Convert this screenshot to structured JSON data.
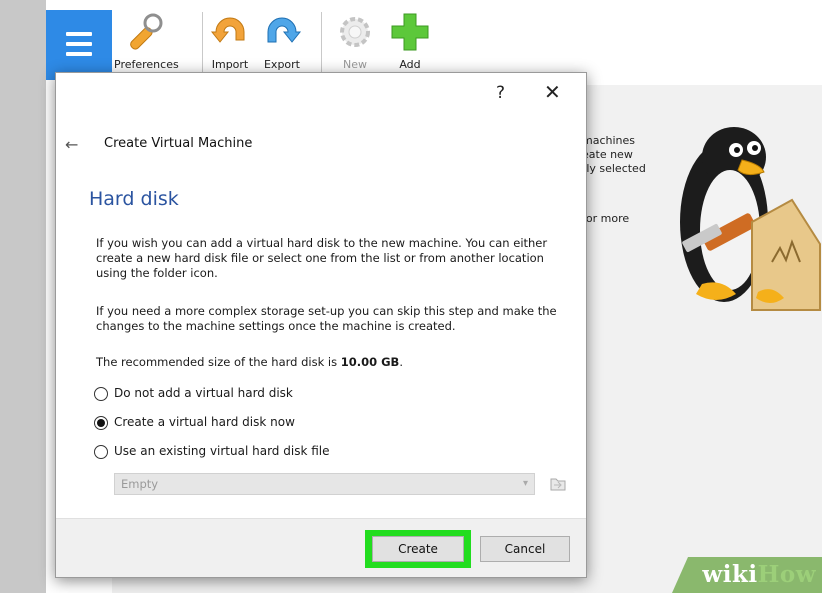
{
  "toolbar": {
    "items": [
      {
        "label": "Preferences",
        "icon": "wrench-icon"
      },
      {
        "label": "Import",
        "icon": "import-arrow-icon"
      },
      {
        "label": "Export",
        "icon": "export-arrow-icon"
      },
      {
        "label": "New",
        "icon": "new-gear-icon"
      },
      {
        "label": "Add",
        "icon": "add-plus-icon"
      }
    ]
  },
  "background": {
    "welcome_lines": [
      "machines",
      "eate new",
      "tly selected",
      "for more"
    ]
  },
  "dialog": {
    "help_label": "?",
    "close_label": "✕",
    "back_label": "←",
    "wizard_title": "Create Virtual Machine",
    "section_title": "Hard disk",
    "para1": "If you wish you can add a virtual hard disk to the new machine. You can either create a new hard disk file or select one from the list or from another location using the folder icon.",
    "para2": "If you need a more complex storage set-up you can skip this step and make the changes to the machine settings once the machine is created.",
    "recommended_prefix": "The recommended size of the hard disk is ",
    "recommended_size": "10.00 GB",
    "recommended_suffix": ".",
    "options": [
      {
        "label": "Do not add a virtual hard disk",
        "checked": false
      },
      {
        "label": "Create a virtual hard disk now",
        "checked": true
      },
      {
        "label": "Use an existing virtual hard disk file",
        "checked": false
      }
    ],
    "file_select_value": "Empty",
    "create_label": "Create",
    "cancel_label": "Cancel"
  },
  "watermark": {
    "wiki": "wiki",
    "how": "How"
  },
  "colors": {
    "section_title": "#2b54a0",
    "highlight": "#22dd1f",
    "tools_button": "#2e8ae6"
  }
}
